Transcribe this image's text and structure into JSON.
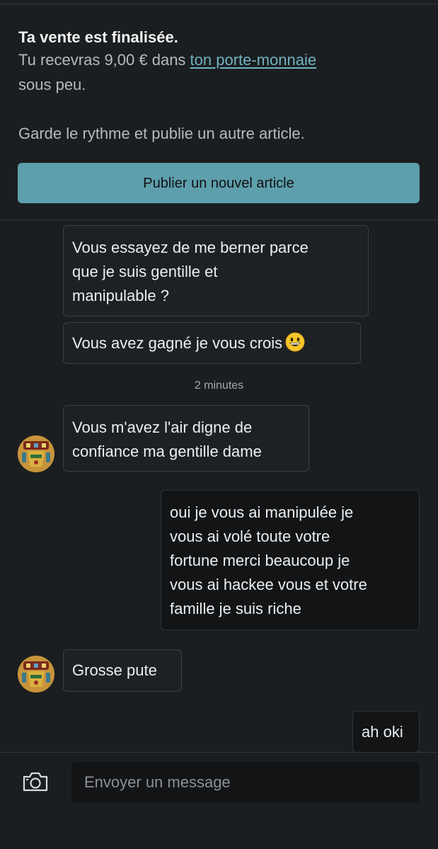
{
  "banner": {
    "title": "Ta vente est finalisée.",
    "line1_prefix": "Tu recevras 9,00 € dans ",
    "line1_link": "ton porte-monnaie",
    "line2": "sous peu.",
    "line3": "Garde le rythme et publie un autre article.",
    "button_label": "Publier un nouvel article",
    "link_color": "#6fb2c0",
    "button_color": "#5e9fad"
  },
  "conversation": {
    "messages": [
      {
        "from": "them",
        "lines": [
          "Vous essayez de me berner parce",
          "que je suis gentille et",
          "manipulable ?"
        ]
      },
      {
        "from": "them",
        "text": "Vous avez gagné je vous crois",
        "emoji": "grinning-face-emoji"
      },
      {
        "from": "other",
        "lines": [
          "Vous m'avez l'air digne de",
          "confiance ma gentille dame"
        ]
      },
      {
        "from": "me",
        "lines": [
          "oui je vous ai manipulée je",
          "vous ai volé toute votre",
          "fortune merci beaucoup je",
          "vous ai hackee vous et votre",
          "famille je suis riche"
        ]
      },
      {
        "from": "other",
        "text": "Grosse pute"
      },
      {
        "from": "me",
        "text": "ah oki"
      }
    ],
    "timestamp": "2 minutes"
  },
  "composer": {
    "placeholder": "Envoyer un message",
    "camera_icon": "camera-icon"
  }
}
